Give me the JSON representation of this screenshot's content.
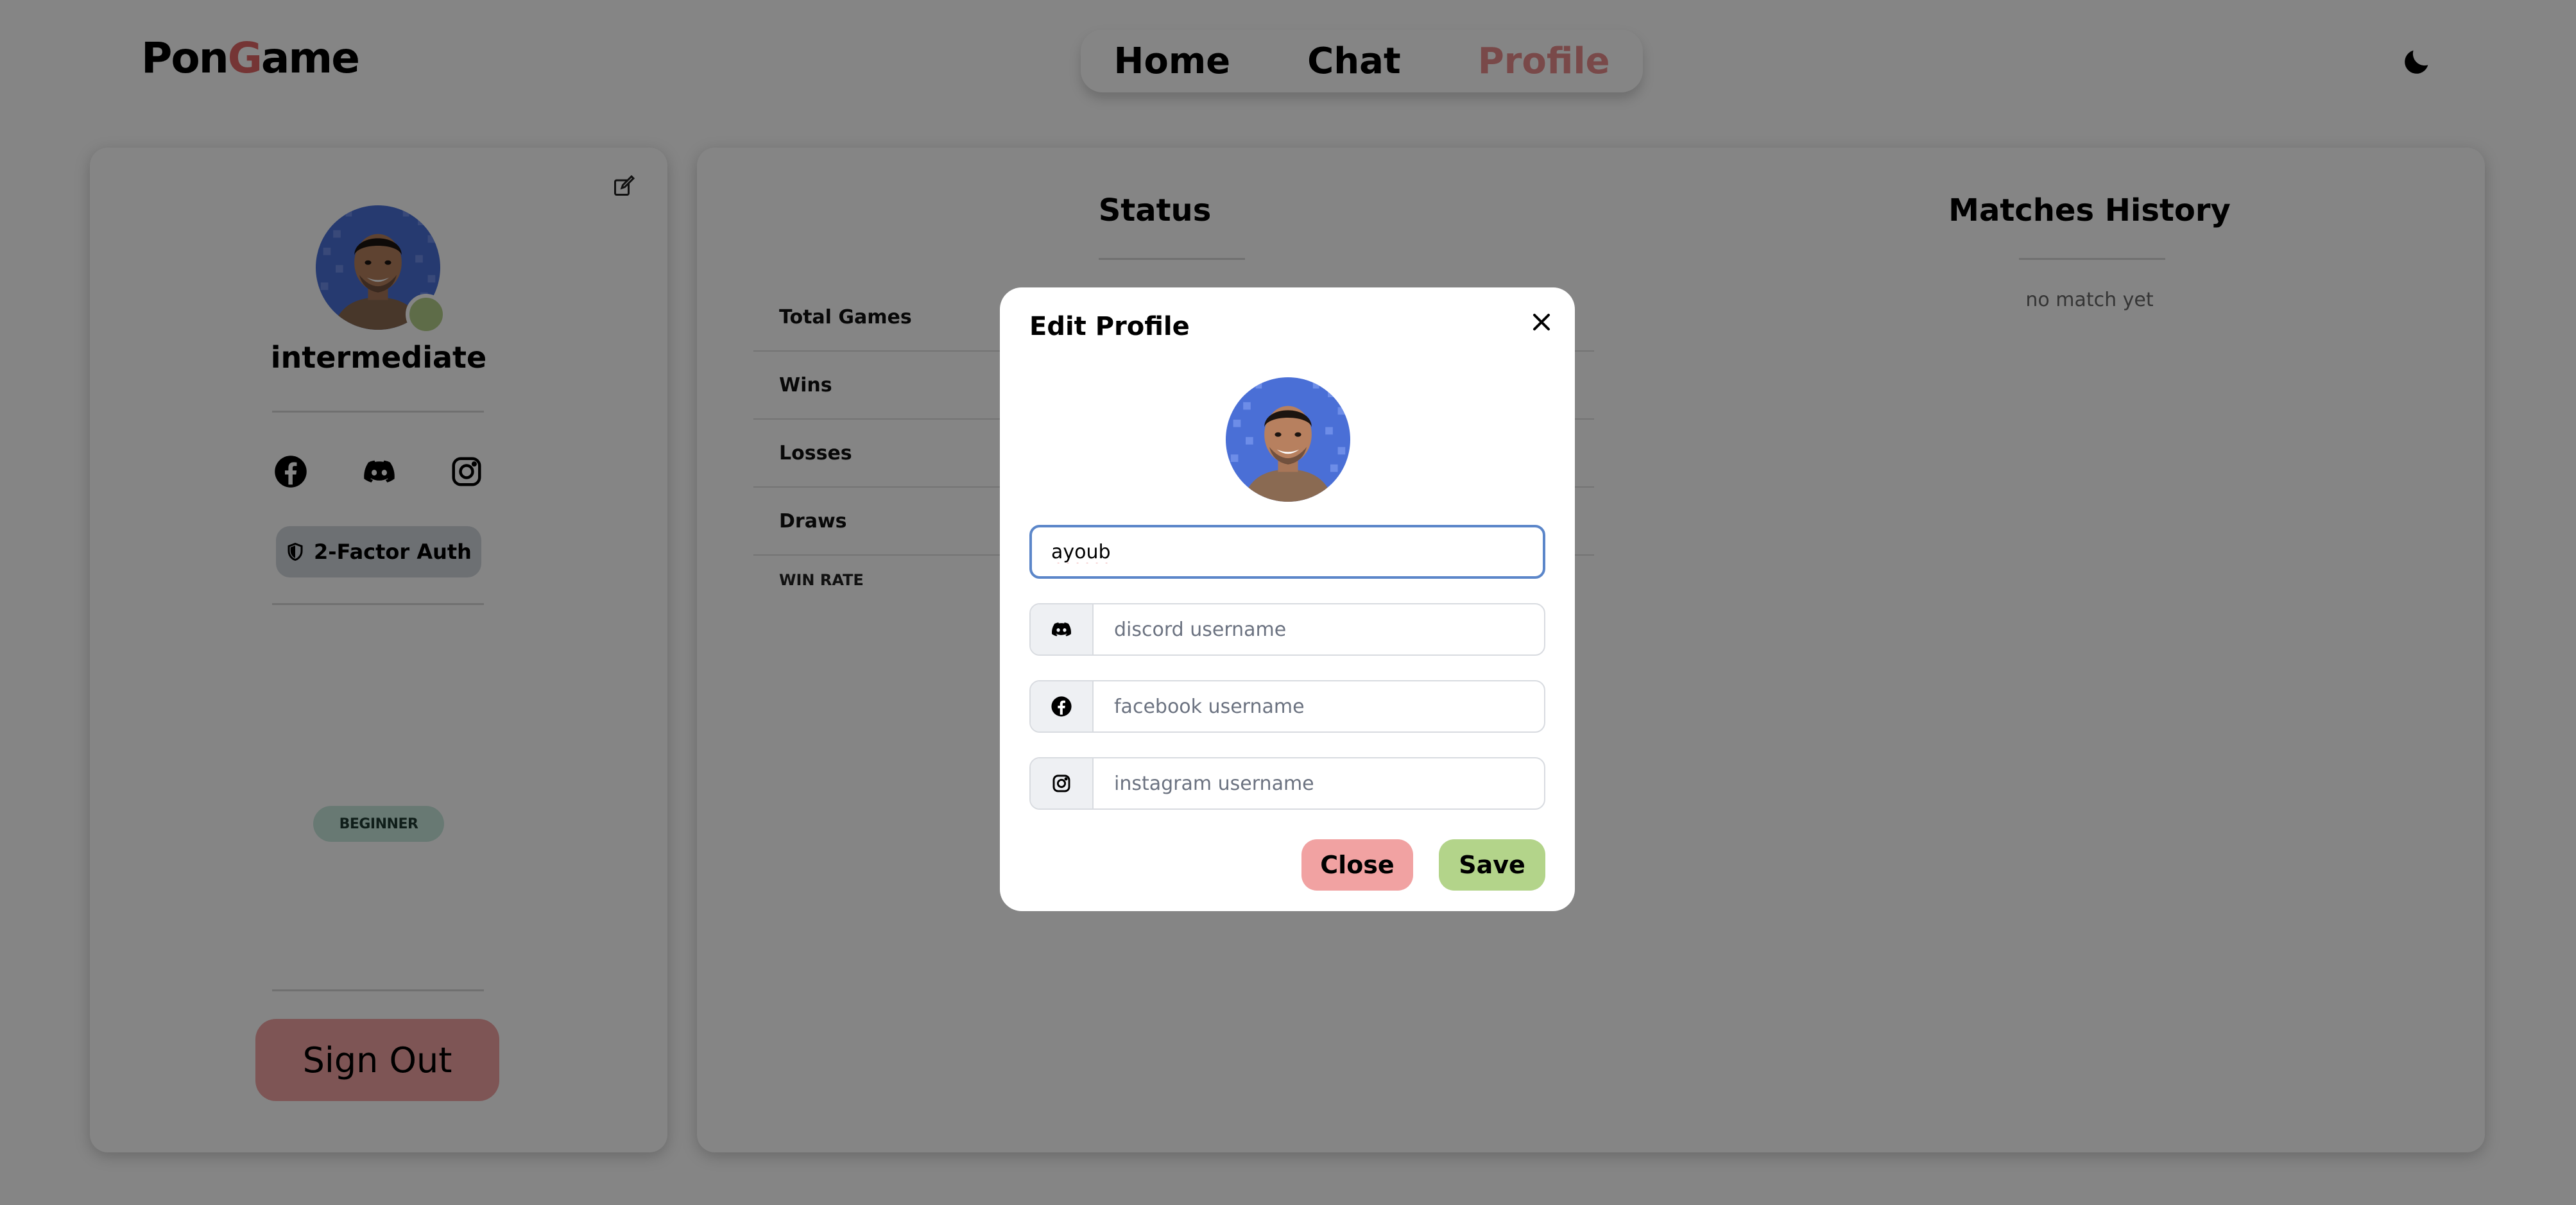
{
  "header": {
    "logo_part1": "Pon",
    "logo_part2": "G",
    "logo_part3": "ame",
    "nav": [
      {
        "label": "Home"
      },
      {
        "label": "Chat"
      },
      {
        "label": "Profile",
        "active": true
      }
    ],
    "theme_icon": "moon-icon"
  },
  "profile_card": {
    "username": "intermediate",
    "status_color": "#b5cf8a",
    "social_icons": [
      "facebook-icon",
      "discord-icon",
      "instagram-icon"
    ],
    "twofa_label": "2-Factor Auth",
    "level": "BEGINNER",
    "signout_label": "Sign Out"
  },
  "stats": {
    "title": "Status",
    "rows": [
      {
        "label": "Total Games"
      },
      {
        "label": "Wins"
      },
      {
        "label": "Losses"
      },
      {
        "label": "Draws"
      }
    ],
    "win_rate_label": "WIN RATE"
  },
  "matches": {
    "title": "Matches History",
    "empty_text": "no match yet"
  },
  "modal": {
    "title": "Edit Profile",
    "username_value": "ayoub",
    "discord_placeholder": "discord username",
    "facebook_placeholder": "facebook username",
    "instagram_placeholder": "instagram username",
    "close_label": "Close",
    "save_label": "Save"
  },
  "colors": {
    "accent_red": "#e06666",
    "active_nav": "#e88c8c",
    "save_green": "#b3d48a",
    "close_red": "#f1a2a2",
    "focus_blue": "#5b86c9"
  }
}
